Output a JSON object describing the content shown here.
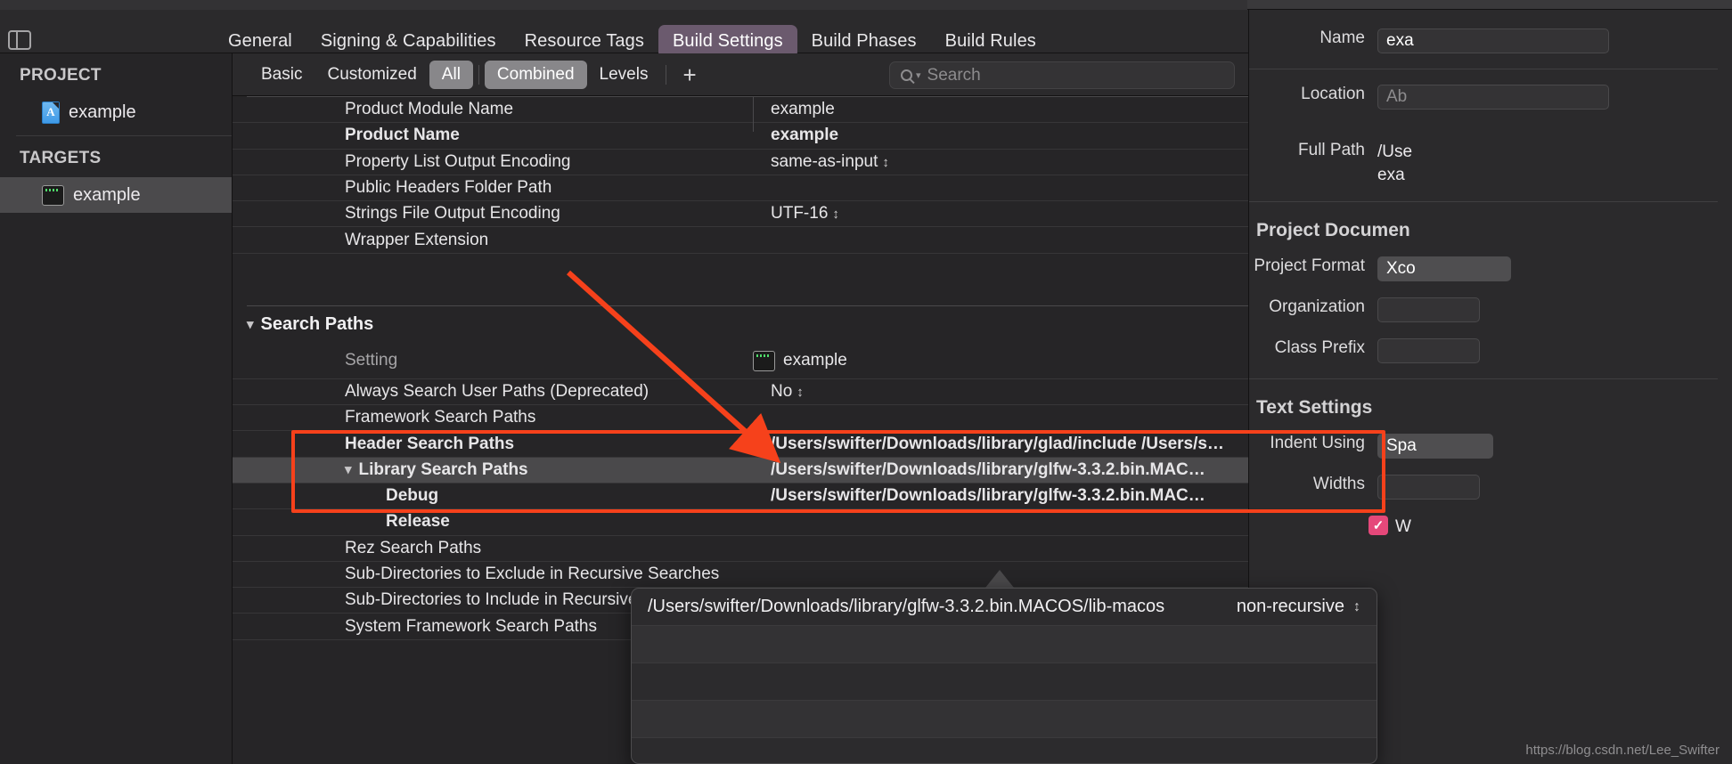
{
  "window": {
    "toolbar_toggle_icon": "sidebar-toggle-icon"
  },
  "tabs": [
    {
      "label": "General",
      "selected": false
    },
    {
      "label": "Signing & Capabilities",
      "selected": false
    },
    {
      "label": "Resource Tags",
      "selected": false
    },
    {
      "label": "Build Settings",
      "selected": true
    },
    {
      "label": "Build Phases",
      "selected": false
    },
    {
      "label": "Build Rules",
      "selected": false
    }
  ],
  "sidebar": {
    "project_header": "PROJECT",
    "project_items": [
      {
        "label": "example",
        "icon": "xcode-project-icon"
      }
    ],
    "targets_header": "TARGETS",
    "target_items": [
      {
        "label": "example",
        "icon": "terminal-target-icon",
        "selected": true
      }
    ]
  },
  "filterbar": {
    "segments": [
      {
        "label": "Basic",
        "active": false
      },
      {
        "label": "Customized",
        "active": false
      },
      {
        "label": "All",
        "active": true
      },
      {
        "label": "Combined",
        "active": true
      },
      {
        "label": "Levels",
        "active": false
      }
    ],
    "add_label": "+",
    "search_placeholder": "Search",
    "search_value": "",
    "search_icon": "search-icon"
  },
  "table": {
    "column_headers": {
      "setting": "Setting",
      "target": "example"
    },
    "top_rows": [
      {
        "name": "Product Module Name",
        "bold": false,
        "value": "example",
        "value_bold": false,
        "stepper": false
      },
      {
        "name": "Product Name",
        "bold": true,
        "value": "example",
        "value_bold": true,
        "stepper": false
      },
      {
        "name": "Property List Output Encoding",
        "bold": false,
        "value": "same-as-input",
        "value_bold": false,
        "stepper": true
      },
      {
        "name": "Public Headers Folder Path",
        "bold": false,
        "value": "",
        "value_bold": false,
        "stepper": false
      },
      {
        "name": "Strings File Output Encoding",
        "bold": false,
        "value": "UTF-16",
        "value_bold": false,
        "stepper": true
      },
      {
        "name": "Wrapper Extension",
        "bold": false,
        "value": "",
        "value_bold": false,
        "stepper": false
      }
    ],
    "section_title": "Search Paths",
    "search_path_rows": [
      {
        "name": "Always Search User Paths (Deprecated)",
        "bold": false,
        "value": "No",
        "value_bold": false,
        "stepper": true,
        "indent": false,
        "disclosure": false,
        "selected": false
      },
      {
        "name": "Framework Search Paths",
        "bold": false,
        "value": "",
        "value_bold": false,
        "stepper": false,
        "indent": false,
        "disclosure": false,
        "selected": false
      },
      {
        "name": "Header Search Paths",
        "bold": true,
        "value": "/Users/swifter/Downloads/library/glad/include /Users/s…",
        "value_bold": true,
        "stepper": false,
        "indent": false,
        "disclosure": false,
        "selected": false
      },
      {
        "name": "Library Search Paths",
        "bold": true,
        "value": "/Users/swifter/Downloads/library/glfw-3.3.2.bin.MAC…",
        "value_bold": true,
        "stepper": false,
        "indent": false,
        "disclosure": true,
        "selected": true
      },
      {
        "name": "Debug",
        "bold": true,
        "value": "/Users/swifter/Downloads/library/glfw-3.3.2.bin.MAC…",
        "value_bold": true,
        "stepper": false,
        "indent": true,
        "disclosure": false,
        "selected": false
      },
      {
        "name": "Release",
        "bold": true,
        "value": "",
        "value_bold": true,
        "stepper": false,
        "indent": true,
        "disclosure": false,
        "selected": false
      },
      {
        "name": "Rez Search Paths",
        "bold": false,
        "value": "",
        "value_bold": false,
        "stepper": false,
        "indent": false,
        "disclosure": false,
        "selected": false
      },
      {
        "name": "Sub-Directories to Exclude in Recursive Searches",
        "bold": false,
        "value": "",
        "value_bold": false,
        "stepper": false,
        "indent": false,
        "disclosure": false,
        "selected": false
      },
      {
        "name": "Sub-Directories to Include in Recursive Searches",
        "bold": false,
        "value": "",
        "value_bold": false,
        "stepper": false,
        "indent": false,
        "disclosure": false,
        "selected": false
      },
      {
        "name": "System Framework Search Paths",
        "bold": false,
        "value": "",
        "value_bold": false,
        "stepper": false,
        "indent": false,
        "disclosure": false,
        "selected": false
      }
    ]
  },
  "popover": {
    "path_value": "/Users/swifter/Downloads/library/glfw-3.3.2.bin.MACOS/lib-macos",
    "recursion_mode": "non-recursive"
  },
  "inspector": {
    "rows": [
      {
        "label": "Name",
        "value": "exa",
        "type": "field"
      },
      {
        "label": "Location",
        "value": "Ab",
        "type": "ghost"
      },
      {
        "label": "Full Path",
        "value": "/Use",
        "value2": "exa",
        "type": "static"
      }
    ],
    "section_title": "Project Documen",
    "doc_rows": [
      {
        "label": "Project Format",
        "value": "Xco",
        "type": "pill"
      },
      {
        "label": "Organization",
        "value": "",
        "type": "empty"
      },
      {
        "label": "Class Prefix",
        "value": "",
        "type": "empty"
      }
    ],
    "text_section_title": "Text Settings",
    "text_rows": [
      {
        "label": "Indent Using",
        "value": "Spa",
        "type": "pill"
      },
      {
        "label": "Widths",
        "value": "",
        "type": "empty"
      }
    ],
    "checkbox_label": "W",
    "checkbox_checked": true
  },
  "annotation": {
    "box_color": "#f6411b",
    "arrow_color": "#f6411b"
  },
  "watermark": "https://blog.csdn.net/Lee_Swifter"
}
